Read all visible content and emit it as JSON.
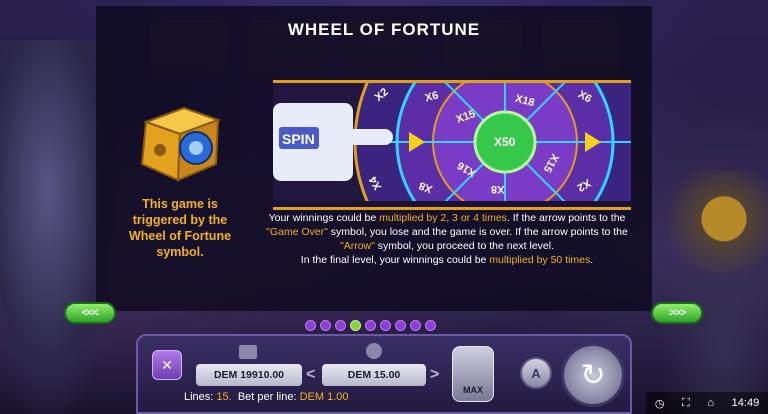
{
  "title": "WHEEL OF FORTUNE",
  "left_text": "This game is triggered by the Wheel of Fortune symbol.",
  "wheel": {
    "spin_label": "SPIN",
    "center_label": "X50",
    "outer_labels": [
      "X2",
      "X6",
      "X18",
      "X6",
      "X4",
      "X8",
      "X8",
      "X2",
      "X15"
    ],
    "inner_labels": [
      "X15",
      "X16",
      "X15"
    ]
  },
  "description": {
    "p1": "Your winnings could be ",
    "h1": "multiplied by 2, 3 or 4 times",
    "p2": ". If the arrow points to the ",
    "h2": "\"Game Over\"",
    "p3": " symbol, you lose and the game is over. If the arrow points to the ",
    "h3": "\"Arrow\"",
    "p4": " symbol, you proceed to the next level.",
    "p5": "In the final level, your winnings could be ",
    "h4": "multiplied by 50 times",
    "p6": "."
  },
  "nav": {
    "prev_label": "<<<",
    "next_label": ">>>"
  },
  "pagination": {
    "count": 9,
    "active_index": 3
  },
  "controls": {
    "close_symbol": "✕",
    "balance": "DEM 19910.00",
    "bet": "DEM 15.00",
    "max_label": "MAX",
    "auto_label": "A",
    "spin_symbol": "↻",
    "lines_label": "Lines:",
    "lines_value": "15.",
    "bet_per_line_label": "Bet per line:",
    "bet_per_line_value": "DEM 1.00"
  },
  "status": {
    "time": "14:49"
  },
  "colors": {
    "accent": "#f2b21b",
    "green": "#2fa32a",
    "purple": "#8a3fd6"
  }
}
